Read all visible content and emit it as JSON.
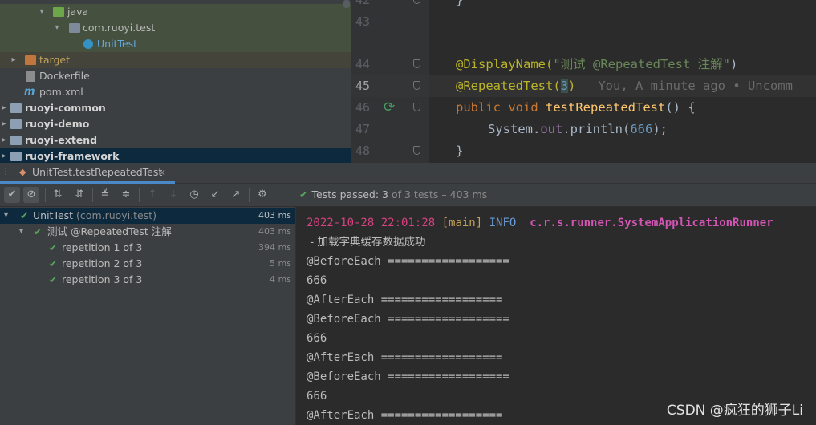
{
  "project_tree": {
    "items": [
      {
        "label": "java",
        "icon": "folder-green-icon",
        "expanded": true
      },
      {
        "label": "com.ruoyi.test",
        "icon": "package-icon",
        "expanded": true
      },
      {
        "label": "UnitTest",
        "icon": "class-icon"
      },
      {
        "label": "target",
        "icon": "folder-orange-icon",
        "expanded": false
      },
      {
        "label": "Dockerfile",
        "icon": "file-icon"
      },
      {
        "label": "pom.xml",
        "icon": "maven-icon"
      },
      {
        "label": "ruoyi-common",
        "icon": "module-folder-icon",
        "expanded": false
      },
      {
        "label": "ruoyi-demo",
        "icon": "module-folder-icon",
        "expanded": false
      },
      {
        "label": "ruoyi-extend",
        "icon": "module-folder-icon",
        "expanded": false
      },
      {
        "label": "ruoyi-framework",
        "icon": "module-folder-icon",
        "expanded": false
      }
    ]
  },
  "editor": {
    "lines": [
      {
        "no": "42",
        "code": "}"
      },
      {
        "no": "43",
        "code": ""
      },
      {
        "no": "44",
        "code_ann": "@DisplayName(",
        "code_str": "\"测试 @RepeatedTest 注解\"",
        "code_end": ")"
      },
      {
        "no": "45",
        "code_ann": "@RepeatedTest(",
        "code_num": "3",
        "code_end": ")",
        "hint": "You, A minute ago • Uncomm"
      },
      {
        "no": "46",
        "kw1": "public",
        "kw2": "void",
        "fn": "testRepeatedTest",
        "rest": "() {"
      },
      {
        "no": "47",
        "cls": "System.",
        "fld": "out",
        "call": ".println(",
        "num": "666",
        "end": ");"
      },
      {
        "no": "48",
        "code": "}"
      }
    ]
  },
  "run_tab": {
    "label": "UnitTest.testRepeatedTest",
    "close": "×"
  },
  "toolbar": {
    "buttons": [
      "show-passed-icon",
      "show-ignored-icon",
      "sort-alpha-icon",
      "sort-duration-icon",
      "expand-all-icon",
      "collapse-all-icon",
      "prev-failed-icon",
      "next-failed-icon",
      "history-icon",
      "import-tests-icon",
      "export-tests-icon",
      "settings-icon"
    ]
  },
  "test_status": {
    "prefix": "Tests passed:",
    "passed": "3",
    "rest": "of 3 tests – 403 ms"
  },
  "test_tree": {
    "rows": [
      {
        "name": "UnitTest",
        "extra": "(com.ruoyi.test)",
        "time": "403 ms"
      },
      {
        "name": "测试 @RepeatedTest 注解",
        "time": "403 ms"
      },
      {
        "name": "repetition 1 of 3",
        "time": "394 ms"
      },
      {
        "name": "repetition 2 of 3",
        "time": "5 ms"
      },
      {
        "name": "repetition 3 of 3",
        "time": "4 ms"
      }
    ]
  },
  "console": {
    "log_date": "2022-10-28 22:01:28",
    "log_thread": "[main]",
    "log_level": "INFO",
    "log_logger": "c.r.s.runner.SystemApplicationRunner",
    "log_message": " - 加载字典缓存数据成功",
    "lines": [
      "@BeforeEach ==================",
      "666",
      "@AfterEach ==================",
      "@BeforeEach ==================",
      "666",
      "@AfterEach ==================",
      "@BeforeEach ==================",
      "666",
      "@AfterEach =================="
    ]
  },
  "watermark": "CSDN @疯狂的狮子Li",
  "colors": {
    "passed_green": "#58a55c",
    "annotation": "#bbb529",
    "keyword": "#cc7832",
    "string": "#6a8759",
    "number": "#6897bb",
    "selection": "#0d293e"
  }
}
